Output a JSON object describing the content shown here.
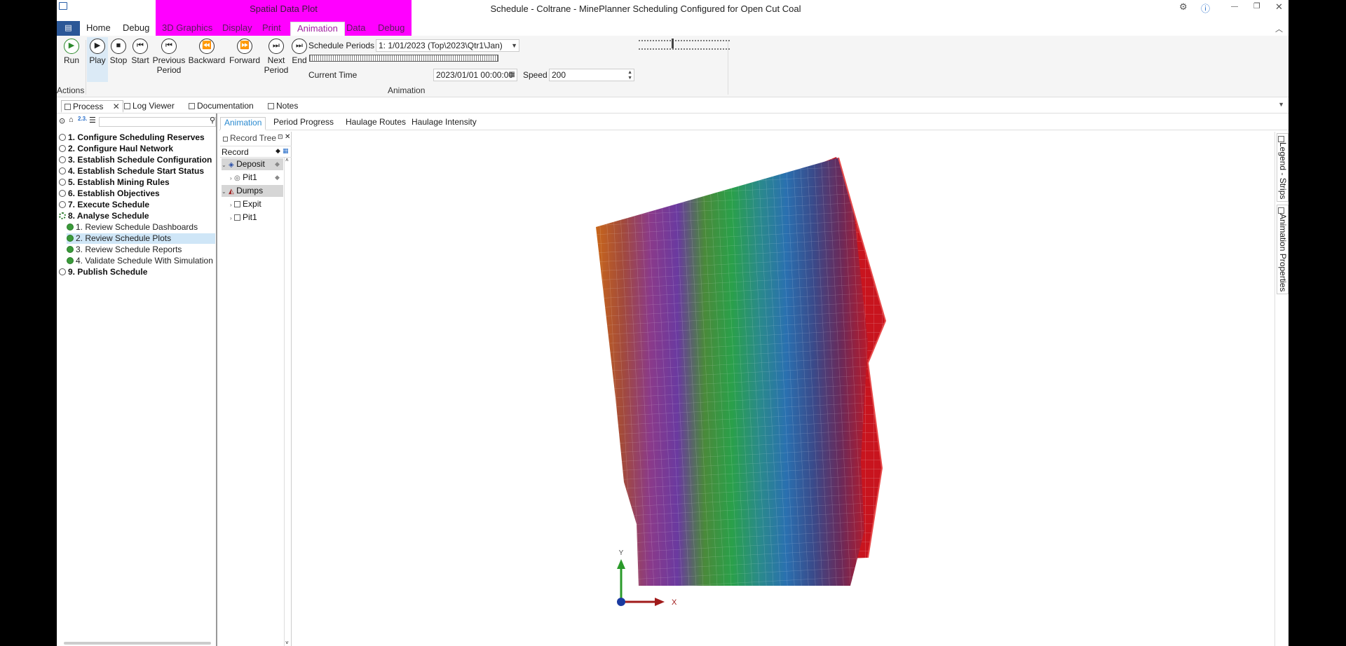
{
  "window": {
    "title": "Schedule - Coltrane - MinePlanner Scheduling Configured for Open Cut Coal",
    "context_group": "Spatial Data Plot",
    "controls": [
      "⚙",
      "ⓘ",
      "—",
      "❐",
      "✕"
    ]
  },
  "ribbon": {
    "tabs": [
      "Home",
      "Debug"
    ],
    "context_tabs": [
      "3D Graphics",
      "Display",
      "Print",
      "Animation",
      "Data",
      "Debug"
    ],
    "active_tab": "Animation",
    "actions": {
      "group_label": "Actions",
      "run": "Run"
    },
    "animation": {
      "group_label": "Animation",
      "play": "Play",
      "stop": "Stop",
      "start": "Start",
      "previous_period_1": "Previous",
      "previous_period_2": "Period",
      "backward": "Backward",
      "forward": "Forward",
      "next_period_1": "Next",
      "next_period_2": "Period",
      "end": "End",
      "schedule_periods_label": "Schedule Periods",
      "schedule_periods_value": "1: 1/01/2023 (Top\\2023\\Qtr1\\Jan)",
      "current_time_label": "Current Time",
      "current_time_value": "2023/01/01 00:00:00",
      "speed_label": "Speed",
      "speed_value": "200"
    }
  },
  "doc_tabs": [
    "Process",
    "Log Viewer",
    "Documentation",
    "Notes"
  ],
  "process": {
    "steps": [
      {
        "label": "1. Configure Scheduling Reserves"
      },
      {
        "label": "2. Configure Haul Network"
      },
      {
        "label": "3. Establish Schedule Configuration"
      },
      {
        "label": "4. Establish Schedule Start Status"
      },
      {
        "label": "5. Establish Mining Rules"
      },
      {
        "label": "6. Establish Objectives"
      },
      {
        "label": "7. Execute Schedule"
      },
      {
        "label": "8. Analyse Schedule"
      },
      {
        "label": "9. Publish Schedule"
      }
    ],
    "substeps": [
      {
        "label": "1. Review Schedule Dashboards"
      },
      {
        "label": "2. Review Schedule Plots"
      },
      {
        "label": "3. Review Schedule Reports"
      },
      {
        "label": "4. Validate Schedule With Simulation"
      }
    ]
  },
  "sub_tabs": [
    "Animation",
    "Period Progress",
    "Haulage Routes",
    "Haulage Intensity"
  ],
  "record_tree": {
    "title": "Record Tree",
    "column": "Record",
    "items": [
      {
        "label": "Deposit"
      },
      {
        "label": "Pit1"
      },
      {
        "label": "Dumps"
      },
      {
        "label": "Expit"
      },
      {
        "label": "Pit1"
      }
    ]
  },
  "axes": {
    "y": "Y",
    "x": "X"
  },
  "right_dock": [
    "Legend - Strips",
    "Animation Properties"
  ]
}
